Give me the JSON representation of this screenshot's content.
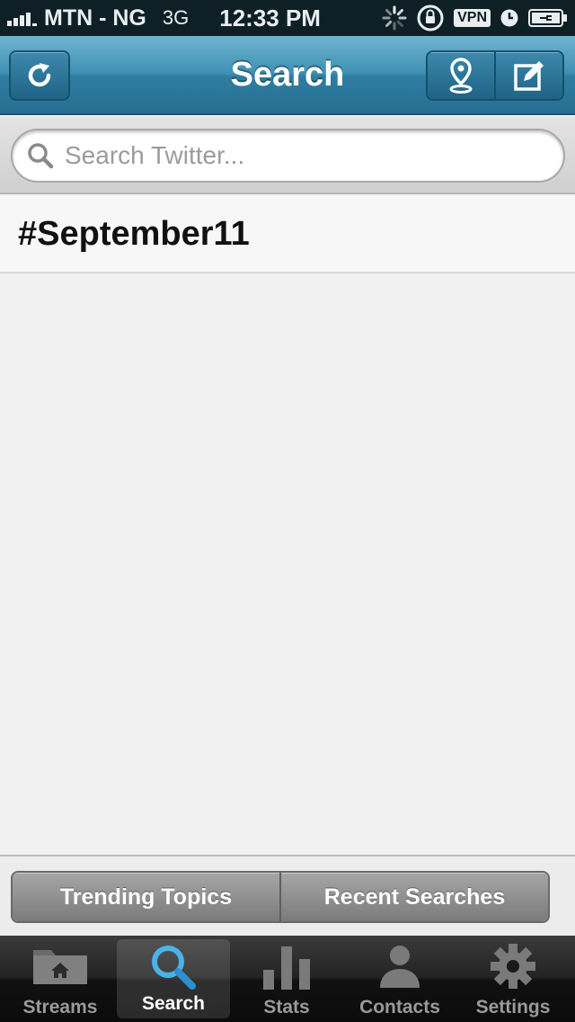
{
  "status_bar": {
    "carrier": "MTN - NG",
    "network": "3G",
    "time": "12:33 PM",
    "vpn_label": "VPN"
  },
  "nav": {
    "title": "Search",
    "refresh_icon": "refresh-icon",
    "location_icon": "location-pin-icon",
    "compose_icon": "compose-icon"
  },
  "search": {
    "placeholder": "Search Twitter..."
  },
  "results": [
    {
      "label": "#September11"
    }
  ],
  "filter": {
    "segments": [
      "Trending Topics",
      "Recent Searches"
    ]
  },
  "tabs": [
    {
      "label": "Streams",
      "icon": "house-folder-icon",
      "active": false
    },
    {
      "label": "Search",
      "icon": "magnifier-icon",
      "active": true
    },
    {
      "label": "Stats",
      "icon": "bar-chart-icon",
      "active": false
    },
    {
      "label": "Contacts",
      "icon": "person-icon",
      "active": false
    },
    {
      "label": "Settings",
      "icon": "gear-icon",
      "active": false
    }
  ],
  "colors": {
    "nav_blue": "#3f90b3",
    "active_tab_icon": "#4ab3ea",
    "status_bar_bg": "#0f1f26"
  }
}
